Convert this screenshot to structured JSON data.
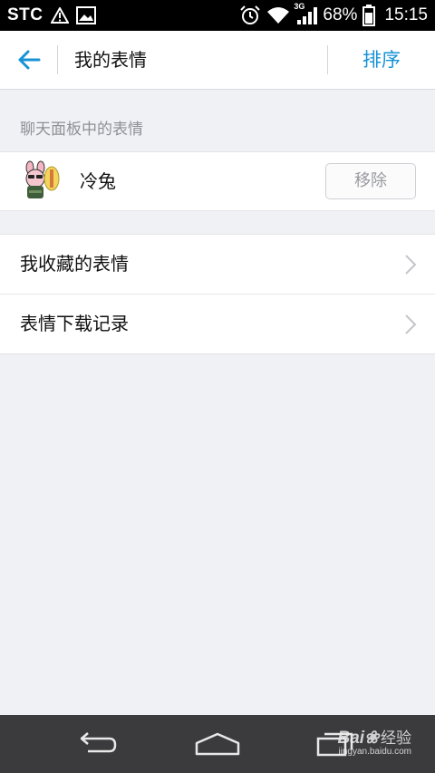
{
  "status_bar": {
    "carrier": "STC",
    "battery_percent": "68%",
    "time": "15:15",
    "network_type": "3G",
    "icons": [
      "warning-icon",
      "image-icon",
      "alarm-icon",
      "wifi-icon",
      "signal-icon",
      "battery-icon"
    ]
  },
  "header": {
    "title": "我的表情",
    "sort_label": "排序",
    "back_icon": "arrow-left-icon"
  },
  "chat_panel_section": {
    "header": "聊天面板中的表情",
    "items": [
      {
        "name": "冷兔",
        "action_label": "移除",
        "thumbnail_icon": "cold-rabbit-sticker-icon"
      }
    ]
  },
  "menu": {
    "items": [
      {
        "label": "我收藏的表情"
      },
      {
        "label": "表情下载记录"
      }
    ]
  },
  "nav_bar": {
    "icons": [
      "back-icon",
      "home-icon",
      "recent-apps-icon"
    ]
  },
  "watermark": {
    "brand": "Bai",
    "brand_suffix": "经验",
    "url": "jingyan.baidu.com"
  },
  "colors": {
    "accent": "#1793d6",
    "background": "#f0f1f5",
    "status_bar": "#000000",
    "nav_bar": "#3b3b3d"
  }
}
